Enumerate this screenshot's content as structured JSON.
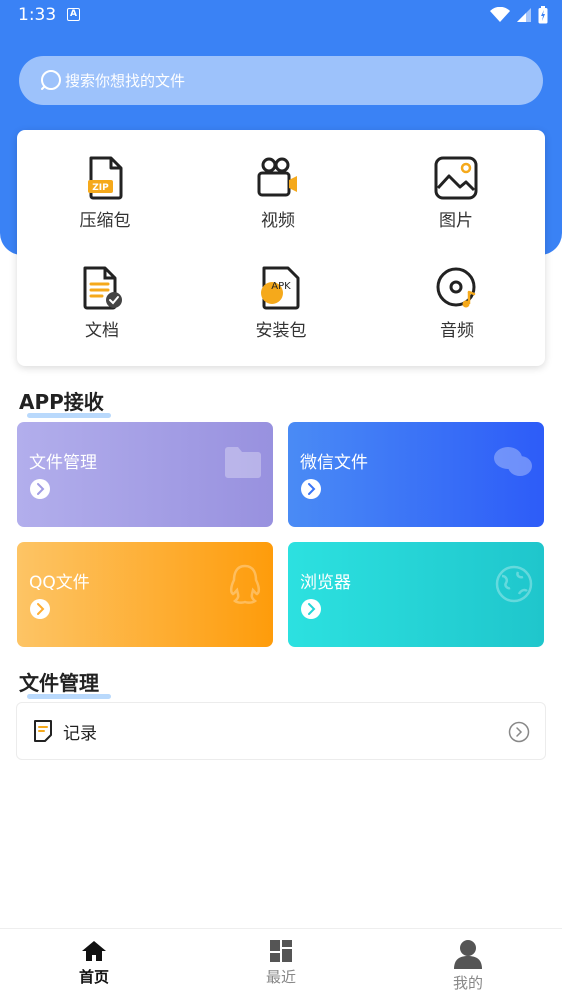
{
  "status_bar": {
    "time": "1:33",
    "notification_letter": "A"
  },
  "search": {
    "placeholder": "搜索你想找的文件"
  },
  "categories": [
    {
      "label": "压缩包",
      "icon": "zip-icon"
    },
    {
      "label": "视频",
      "icon": "video-camera-icon"
    },
    {
      "label": "图片",
      "icon": "image-icon"
    },
    {
      "label": "文档",
      "icon": "document-icon"
    },
    {
      "label": "安装包",
      "icon": "apk-icon",
      "badge": "APK"
    },
    {
      "label": "音频",
      "icon": "audio-disc-icon"
    }
  ],
  "app_receive": {
    "title": "APP接收",
    "cards": [
      {
        "label": "文件管理",
        "icon": "folder-icon"
      },
      {
        "label": "微信文件",
        "icon": "wechat-icon"
      },
      {
        "label": "QQ文件",
        "icon": "qq-icon"
      },
      {
        "label": "浏览器",
        "icon": "globe-icon"
      }
    ]
  },
  "file_management": {
    "title": "文件管理",
    "rows": [
      {
        "label": "记录",
        "icon": "record-icon"
      }
    ]
  },
  "bottom_nav": {
    "items": [
      {
        "label": "首页",
        "icon": "home-icon",
        "active": true
      },
      {
        "label": "最近",
        "icon": "recent-grid-icon",
        "active": false
      },
      {
        "label": "我的",
        "icon": "person-icon",
        "active": false
      }
    ]
  },
  "colors": {
    "header": "#3a82f5",
    "accent_orange": "#f5a91b",
    "file_manager_card": "#a29de4",
    "wechat_card": "#3b75f6",
    "qq_card": "#feae34",
    "browser_card": "#25d5d7"
  }
}
